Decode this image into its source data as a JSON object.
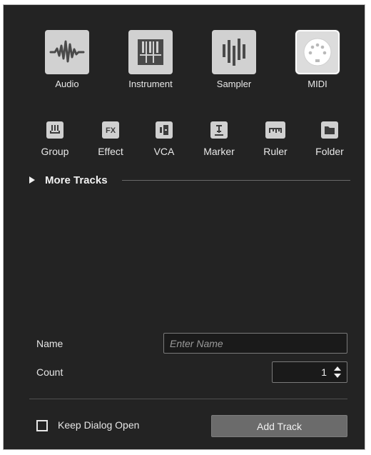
{
  "track_types": {
    "main": [
      {
        "key": "audio",
        "label": "Audio",
        "icon": "audio-waveform-icon",
        "selected": false
      },
      {
        "key": "instrument",
        "label": "Instrument",
        "icon": "piano-keys-icon",
        "selected": false
      },
      {
        "key": "sampler",
        "label": "Sampler",
        "icon": "sampler-bars-icon",
        "selected": false
      },
      {
        "key": "midi",
        "label": "MIDI",
        "icon": "midi-connector-icon",
        "selected": true
      }
    ],
    "other": [
      {
        "key": "group",
        "label": "Group",
        "icon": "group-icon"
      },
      {
        "key": "effect",
        "label": "Effect",
        "icon": "fx-icon",
        "icon_text": "FX"
      },
      {
        "key": "vca",
        "label": "VCA",
        "icon": "vca-fader-icon"
      },
      {
        "key": "marker",
        "label": "Marker",
        "icon": "marker-icon"
      },
      {
        "key": "ruler",
        "label": "Ruler",
        "icon": "ruler-icon"
      },
      {
        "key": "folder",
        "label": "Folder",
        "icon": "folder-icon"
      }
    ]
  },
  "more_tracks": {
    "label": "More Tracks",
    "expanded": false
  },
  "form": {
    "name_label": "Name",
    "name_value": "",
    "name_placeholder": "Enter Name",
    "count_label": "Count",
    "count_value": "1"
  },
  "footer": {
    "keep_open_label": "Keep Dialog Open",
    "keep_open_checked": false,
    "add_button_label": "Add Track"
  },
  "colors": {
    "background": "#232323",
    "tile": "#d1d1d1",
    "icon": "#4a4a4a",
    "button": "#6b6b6b"
  }
}
